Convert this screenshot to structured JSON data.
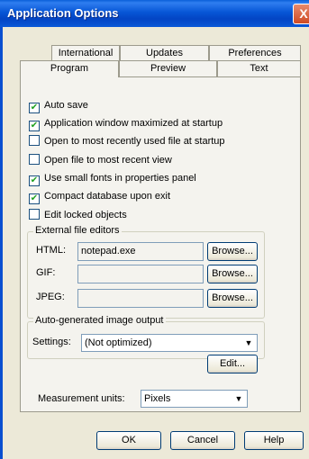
{
  "window": {
    "title": "Application Options",
    "close_glyph": "X"
  },
  "tabs": {
    "row1": [
      "International",
      "Updates",
      "Preferences"
    ],
    "row2": [
      "Program",
      "Preview",
      "Text"
    ],
    "active": "Program"
  },
  "checkboxes": [
    {
      "label": "Auto save",
      "checked": true
    },
    {
      "label": "Application window maximized at startup",
      "checked": true
    },
    {
      "label": "Open to most recently used file at startup",
      "checked": false
    },
    {
      "label": "Open file to most recent view",
      "checked": false
    },
    {
      "label": "Use small fonts in properties panel",
      "checked": true
    },
    {
      "label": "Compact database upon exit",
      "checked": true
    },
    {
      "label": "Edit locked objects",
      "checked": false
    }
  ],
  "external_editors": {
    "group_label": "External file editors",
    "rows": [
      {
        "label": "HTML:",
        "value": "notepad.exe",
        "button": "Browse..."
      },
      {
        "label": "GIF:",
        "value": "",
        "button": "Browse..."
      },
      {
        "label": "JPEG:",
        "value": "",
        "button": "Browse..."
      }
    ]
  },
  "image_output": {
    "group_label": "Auto-generated image output",
    "settings_label": "Settings:",
    "settings_value": "(Not optimized)",
    "edit_button": "Edit..."
  },
  "measurement": {
    "label": "Measurement units:",
    "value": "Pixels"
  },
  "footer": {
    "ok": "OK",
    "cancel": "Cancel",
    "help": "Help"
  },
  "icons": {
    "checkmark": "check-icon",
    "dropdown": "dropdown-arrow-icon"
  }
}
